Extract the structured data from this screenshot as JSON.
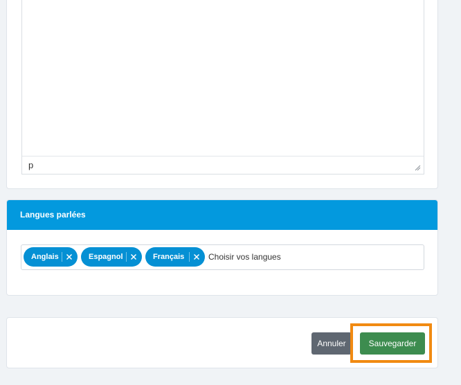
{
  "editor": {
    "path": "p"
  },
  "languages": {
    "title": "Langues parlées",
    "tags": [
      {
        "label": "Anglais"
      },
      {
        "label": "Espagnol"
      },
      {
        "label": "Français"
      }
    ],
    "placeholder": "Choisir vos langues"
  },
  "actions": {
    "cancel_label": "Annuler",
    "save_label": "Sauvegarder"
  },
  "colors": {
    "accent": "#0399de",
    "tag": "#0590d4",
    "save": "#3d8c4f",
    "cancel": "#5f6771",
    "highlight": "#f18a12"
  },
  "icons": [
    "remove-tag-icon",
    "resize-handle-icon"
  ]
}
